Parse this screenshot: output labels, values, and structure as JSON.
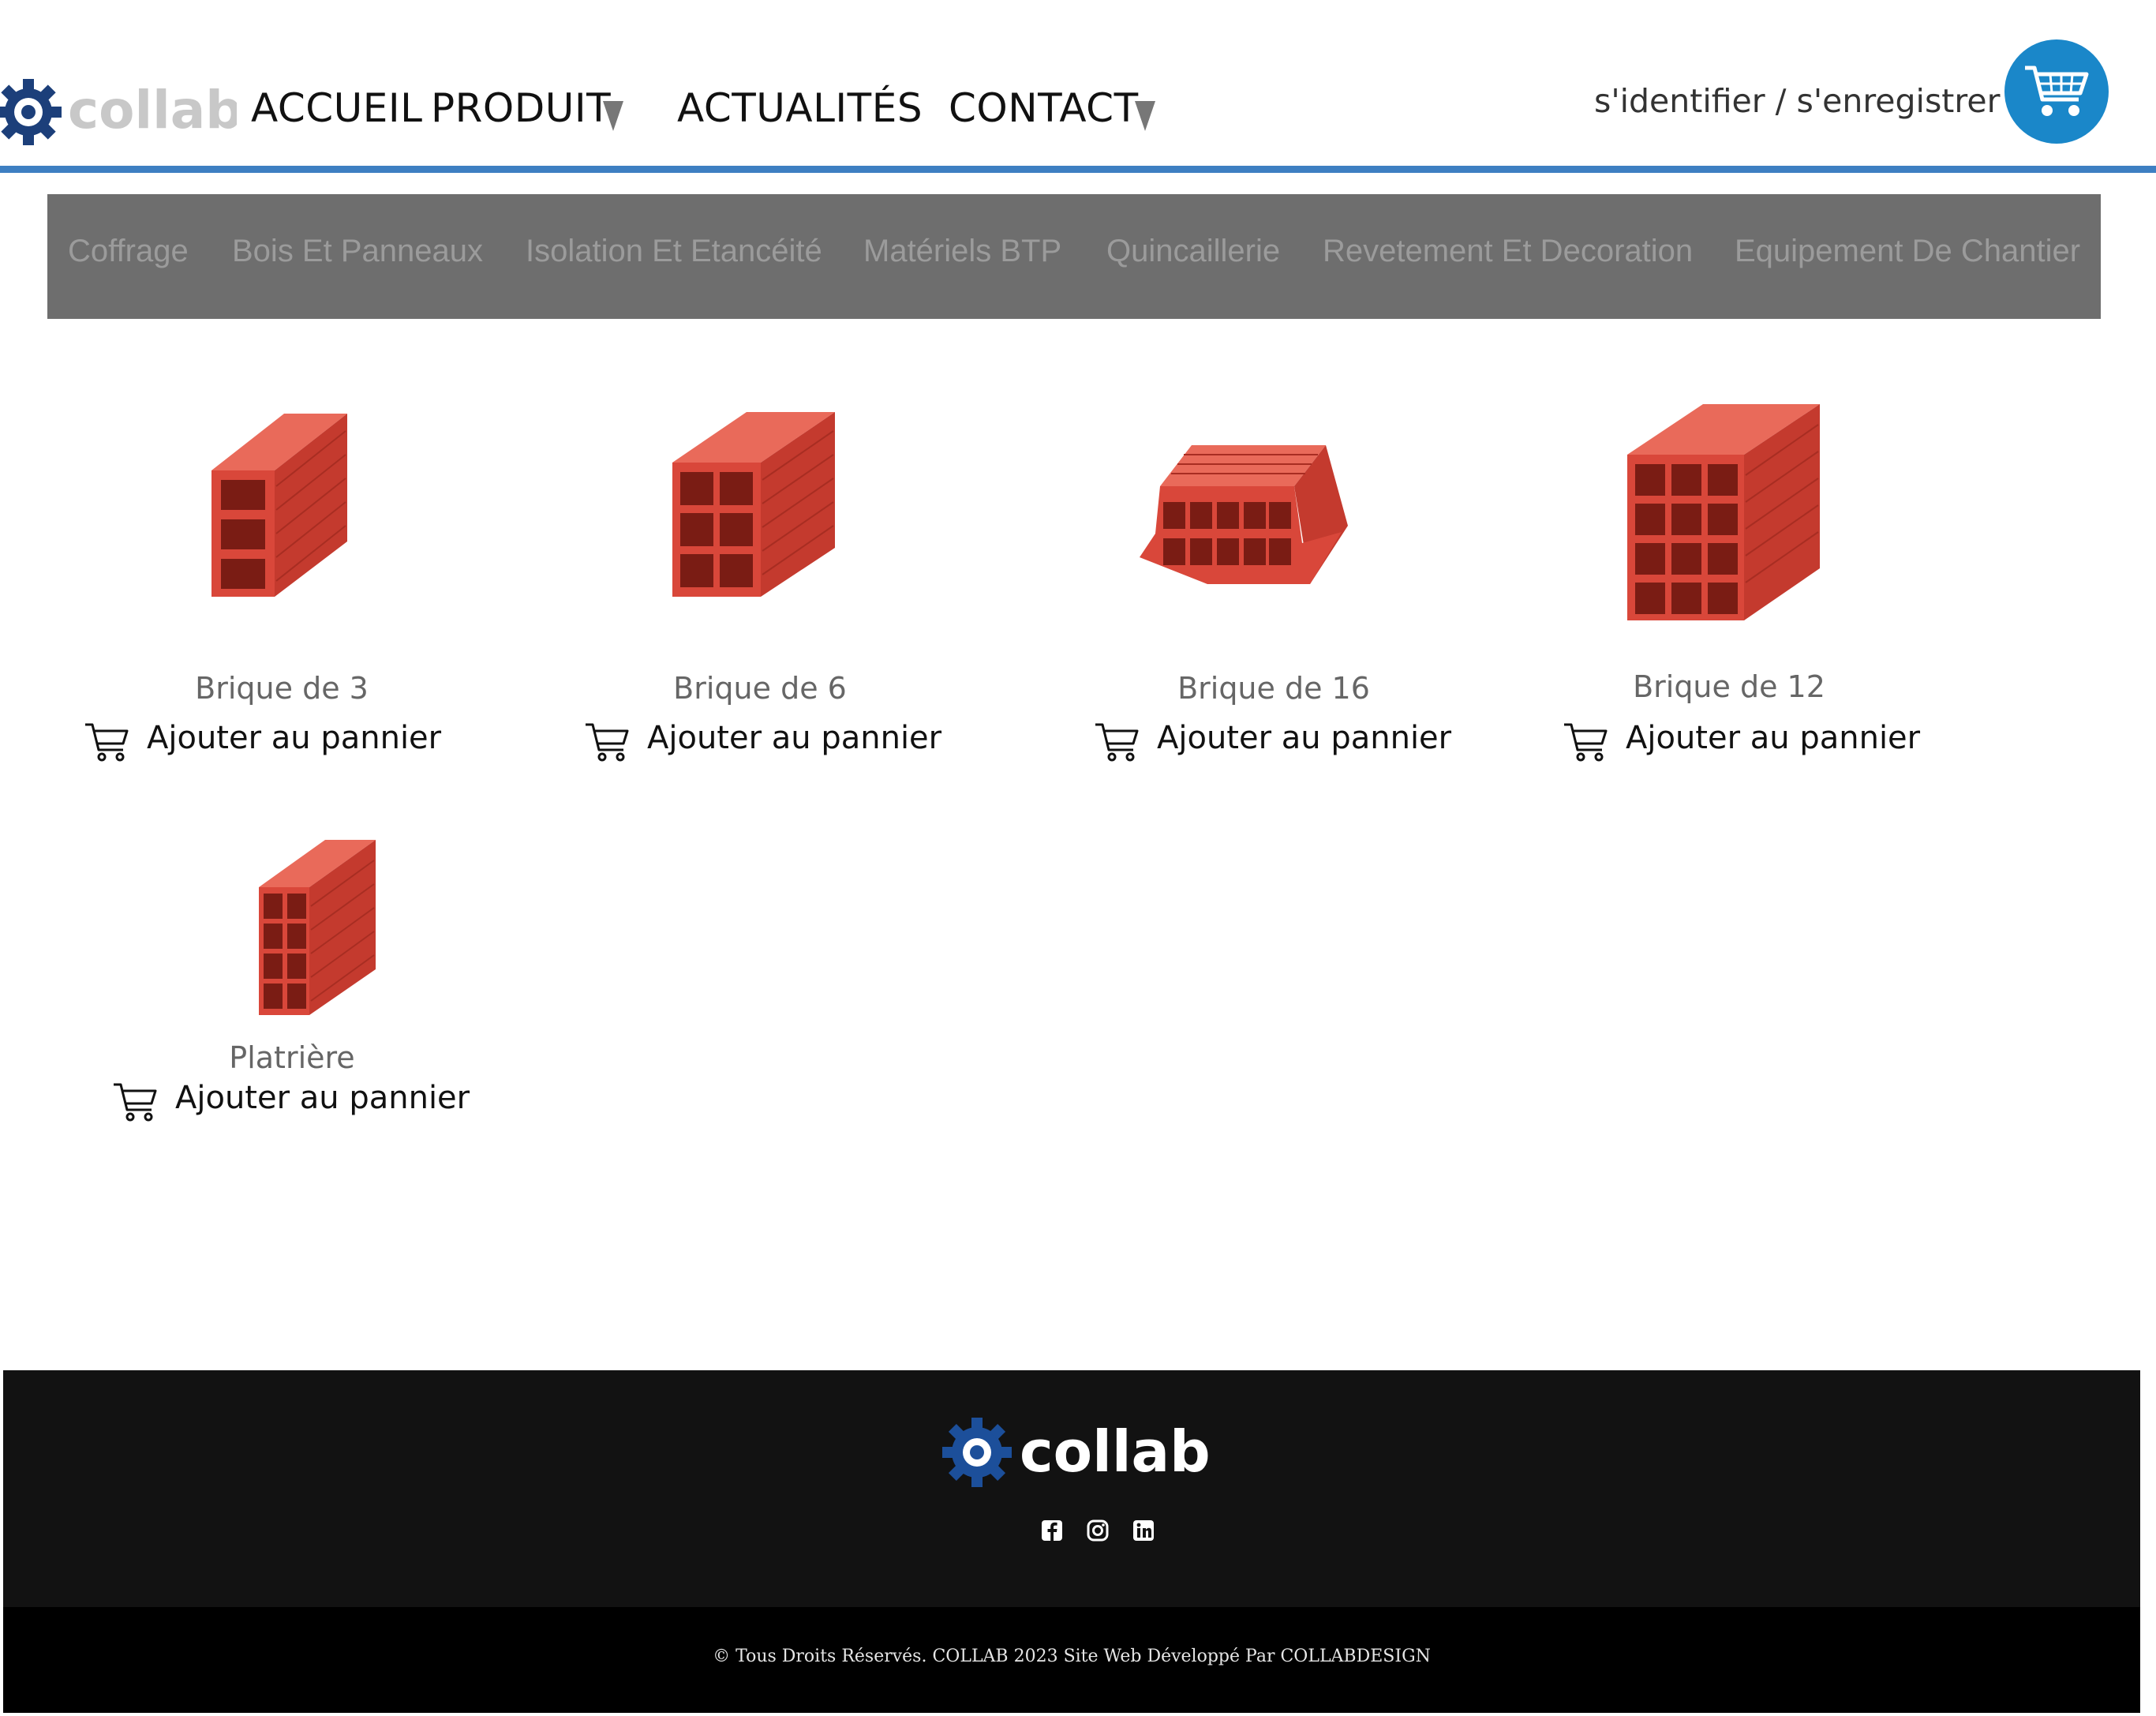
{
  "brand": {
    "logo_text": "collab",
    "accent_color": "#1a87c9",
    "header_line_color": "#3d7fc2"
  },
  "nav": {
    "items": [
      "ACCUEIL",
      "PRODUIT",
      "ACTUALITÉS",
      "CONTACT"
    ],
    "produit_has_dropdown": true,
    "contact_has_dropdown": true
  },
  "account": {
    "login_label": "s'identifier / s'enregistrer"
  },
  "header_icons": {
    "cart": "shopping-cart-icon"
  },
  "categories": [
    "Coffrage",
    "Bois Et Panneaux",
    "Isolation Et Etancéité",
    "Matériels BTP",
    "Quincaillerie",
    "Revetement Et Decoration",
    "Equipement De Chantier"
  ],
  "products": [
    {
      "name": "Brique de 3",
      "add_label": "Ajouter au pannier"
    },
    {
      "name": "Brique de 6",
      "add_label": "Ajouter au pannier"
    },
    {
      "name": "Brique de 16",
      "add_label": "Ajouter au pannier"
    },
    {
      "name": "Brique de 12",
      "add_label": "Ajouter au pannier"
    },
    {
      "name": "Platrière",
      "add_label": "Ajouter au pannier"
    }
  ],
  "footer": {
    "logo_text": "collab",
    "social": [
      "facebook-icon",
      "instagram-icon",
      "linkedin-icon"
    ],
    "copyright": "© Tous Droits Réservés. COLLAB 2023 Site Web Développé Par COLLABDESIGN"
  },
  "colors": {
    "brick": "#d9473a",
    "category_bar": "#6e6e6e",
    "footer_top": "#121212",
    "footer_bottom": "#000000"
  }
}
